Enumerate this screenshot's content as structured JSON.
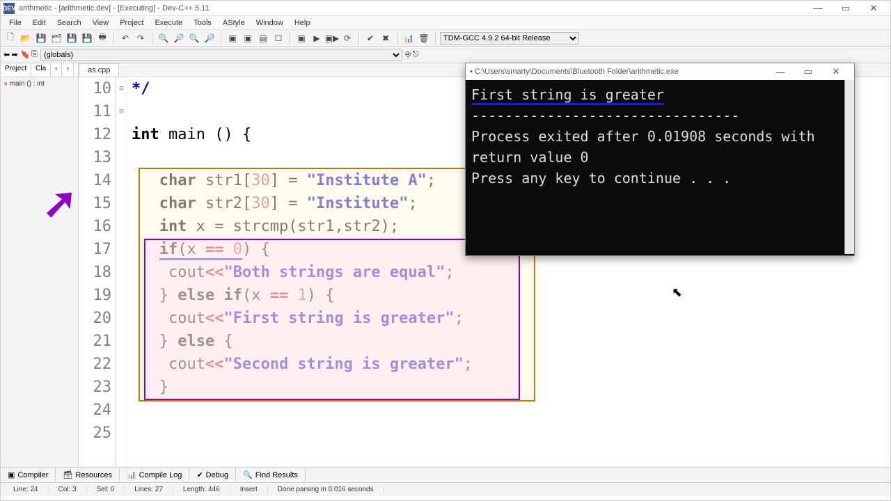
{
  "title": "arithmetic - [arithmetic.dev] - [Executing] - Dev-C++ 5.11",
  "app_icon": "DEV",
  "menus": [
    "File",
    "Edit",
    "Search",
    "View",
    "Project",
    "Execute",
    "Tools",
    "AStyle",
    "Window",
    "Help"
  ],
  "compiler_select": "TDM-GCC 4.9.2 64-bit Release",
  "globals_select": "(globals)",
  "side_tabs": {
    "project": "Project",
    "classes": "Cla",
    "nav_l": "‹",
    "nav_r": "›"
  },
  "tree_item": "main () : int",
  "editor_tab": "as.cpp",
  "code": {
    "lines": [
      {
        "n": "10",
        "raw": "*/",
        "cls": "cmt"
      },
      {
        "n": "11",
        "raw": ""
      },
      {
        "n": "12",
        "fold": "⊟",
        "parts": [
          {
            "t": "int ",
            "c": "kw"
          },
          {
            "t": "main () ",
            "c": ""
          },
          {
            "t": "{",
            "c": ""
          }
        ]
      },
      {
        "n": "13",
        "raw": ""
      },
      {
        "n": "14",
        "parts": [
          {
            "t": "   ",
            "c": ""
          },
          {
            "t": "char ",
            "c": "kw"
          },
          {
            "t": "str1[",
            "c": ""
          },
          {
            "t": "30",
            "c": "num"
          },
          {
            "t": "] = ",
            "c": ""
          },
          {
            "t": "\"Institute A\"",
            "c": "str"
          },
          {
            "t": ";",
            "c": ""
          }
        ]
      },
      {
        "n": "15",
        "parts": [
          {
            "t": "   ",
            "c": ""
          },
          {
            "t": "char ",
            "c": "kw"
          },
          {
            "t": "str2[",
            "c": ""
          },
          {
            "t": "30",
            "c": "num"
          },
          {
            "t": "] = ",
            "c": ""
          },
          {
            "t": "\"Institute\"",
            "c": "str"
          },
          {
            "t": ";",
            "c": ""
          }
        ]
      },
      {
        "n": "16",
        "parts": [
          {
            "t": "   ",
            "c": ""
          },
          {
            "t": "int ",
            "c": "kw"
          },
          {
            "t": "x = strcmp(str1,str2);",
            "c": ""
          }
        ]
      },
      {
        "n": "17",
        "fold": "⊟",
        "parts": [
          {
            "t": "   ",
            "c": ""
          },
          {
            "t": "if",
            "c": "kw"
          },
          {
            "t": "(x ",
            "c": ""
          },
          {
            "t": "==",
            "c": "op"
          },
          {
            "t": " ",
            "c": ""
          },
          {
            "t": "0",
            "c": "num"
          },
          {
            "t": ") {",
            "c": ""
          }
        ]
      },
      {
        "n": "18",
        "parts": [
          {
            "t": "    cout",
            "c": ""
          },
          {
            "t": "<<",
            "c": "op"
          },
          {
            "t": "\"Both strings are equal\"",
            "c": "str"
          },
          {
            "t": ";",
            "c": ""
          }
        ]
      },
      {
        "n": "19",
        "parts": [
          {
            "t": "   } ",
            "c": ""
          },
          {
            "t": "else if",
            "c": "kw"
          },
          {
            "t": "(x ",
            "c": ""
          },
          {
            "t": "==",
            "c": "op"
          },
          {
            "t": " ",
            "c": ""
          },
          {
            "t": "1",
            "c": "num"
          },
          {
            "t": ") {",
            "c": ""
          }
        ]
      },
      {
        "n": "20",
        "parts": [
          {
            "t": "    cout",
            "c": ""
          },
          {
            "t": "<<",
            "c": "op"
          },
          {
            "t": "\"First string is greater\"",
            "c": "str"
          },
          {
            "t": ";",
            "c": ""
          }
        ]
      },
      {
        "n": "21",
        "parts": [
          {
            "t": "   } ",
            "c": ""
          },
          {
            "t": "else",
            "c": "kw"
          },
          {
            "t": " {",
            "c": ""
          }
        ]
      },
      {
        "n": "22",
        "parts": [
          {
            "t": "    cout",
            "c": ""
          },
          {
            "t": "<<",
            "c": "op"
          },
          {
            "t": "\"Second string is greater\"",
            "c": "str"
          },
          {
            "t": ";",
            "c": ""
          }
        ]
      },
      {
        "n": "23",
        "parts": [
          {
            "t": "   }",
            "c": ""
          }
        ]
      },
      {
        "n": "24",
        "raw": ""
      },
      {
        "n": "25",
        "raw": ""
      }
    ]
  },
  "console": {
    "title": "C:\\Users\\smarty\\Documents\\Bluetooth Folder\\arithmetic.exe",
    "output1": "First string is greater",
    "dashes": "--------------------------------",
    "output2": "Process exited after 0.01908 seconds with return value 0",
    "output3": "Press any key to continue . . ."
  },
  "bottom_tabs": [
    "Compiler",
    "Resources",
    "Compile Log",
    "Debug",
    "Find Results"
  ],
  "status": {
    "line": "Line:   24",
    "col": "Col:   3",
    "sel": "Sel:   0",
    "lines": "Lines:   27",
    "length": "Length:   446",
    "insert": "Insert",
    "parse": "Done parsing in 0.016 seconds"
  },
  "icons": {
    "new": "🗋",
    "open": "📂",
    "save": "💾",
    "saveall": "🗂",
    "print": "🖶",
    "undo": "↶",
    "redo": "↷",
    "find": "🔍",
    "findnext": "🔎",
    "compile": "▣",
    "run": "▶",
    "compilerun": "▣▶",
    "rebuild": "⟳",
    "debug": "✔",
    "stop": "✖",
    "profile": "📊",
    "del": "🗑",
    "back": "⬅",
    "fwd": "➡",
    "bookmark": "🔖",
    "goto": "⎘",
    "dbg1": "⎆",
    "dbg2": "⎋"
  }
}
